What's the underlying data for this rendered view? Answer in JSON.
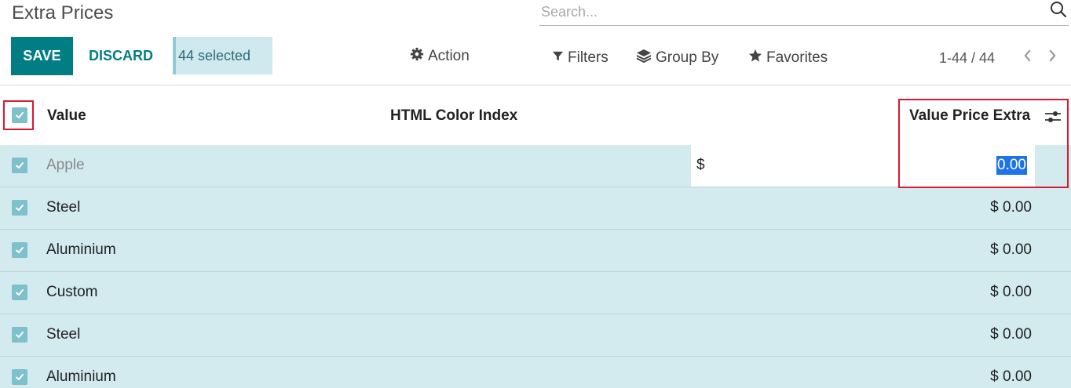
{
  "page": {
    "title": "Extra Prices"
  },
  "search": {
    "placeholder": "Search..."
  },
  "toolbar": {
    "save_label": "SAVE",
    "discard_label": "DISCARD",
    "selected_text": "44 selected",
    "action_label": "Action",
    "filters_label": "Filters",
    "groupby_label": "Group By",
    "favorites_label": "Favorites"
  },
  "pager": {
    "value": "1-44 / 44"
  },
  "list": {
    "columns": {
      "value": "Value",
      "html_color_index": "HTML Color Index",
      "price_extra": "Value Price Extra"
    },
    "editing_row": {
      "name": "Apple",
      "currency": "$",
      "price_input": "0.00"
    },
    "rows": [
      {
        "name": "Steel",
        "price": "$ 0.00"
      },
      {
        "name": "Aluminium",
        "price": "$ 0.00"
      },
      {
        "name": "Custom",
        "price": "$ 0.00"
      },
      {
        "name": "Steel",
        "price": "$ 0.00"
      },
      {
        "name": "Aluminium",
        "price": "$ 0.00"
      }
    ]
  },
  "colors": {
    "brand": "#017e84",
    "row_selected": "#d3eaef",
    "checkbox": "#7ec0cc",
    "highlight_box": "#d9192e",
    "text_selection": "#1e73e8"
  },
  "icons": {
    "search": "search-icon",
    "action": "gear-icon",
    "filters": "filter-icon",
    "groupby": "layers-icon",
    "favorites": "star-icon",
    "pager_prev": "chevron-left-icon",
    "pager_next": "chevron-right-icon",
    "optional_columns": "sliders-icon",
    "checkbox": "check-icon"
  }
}
